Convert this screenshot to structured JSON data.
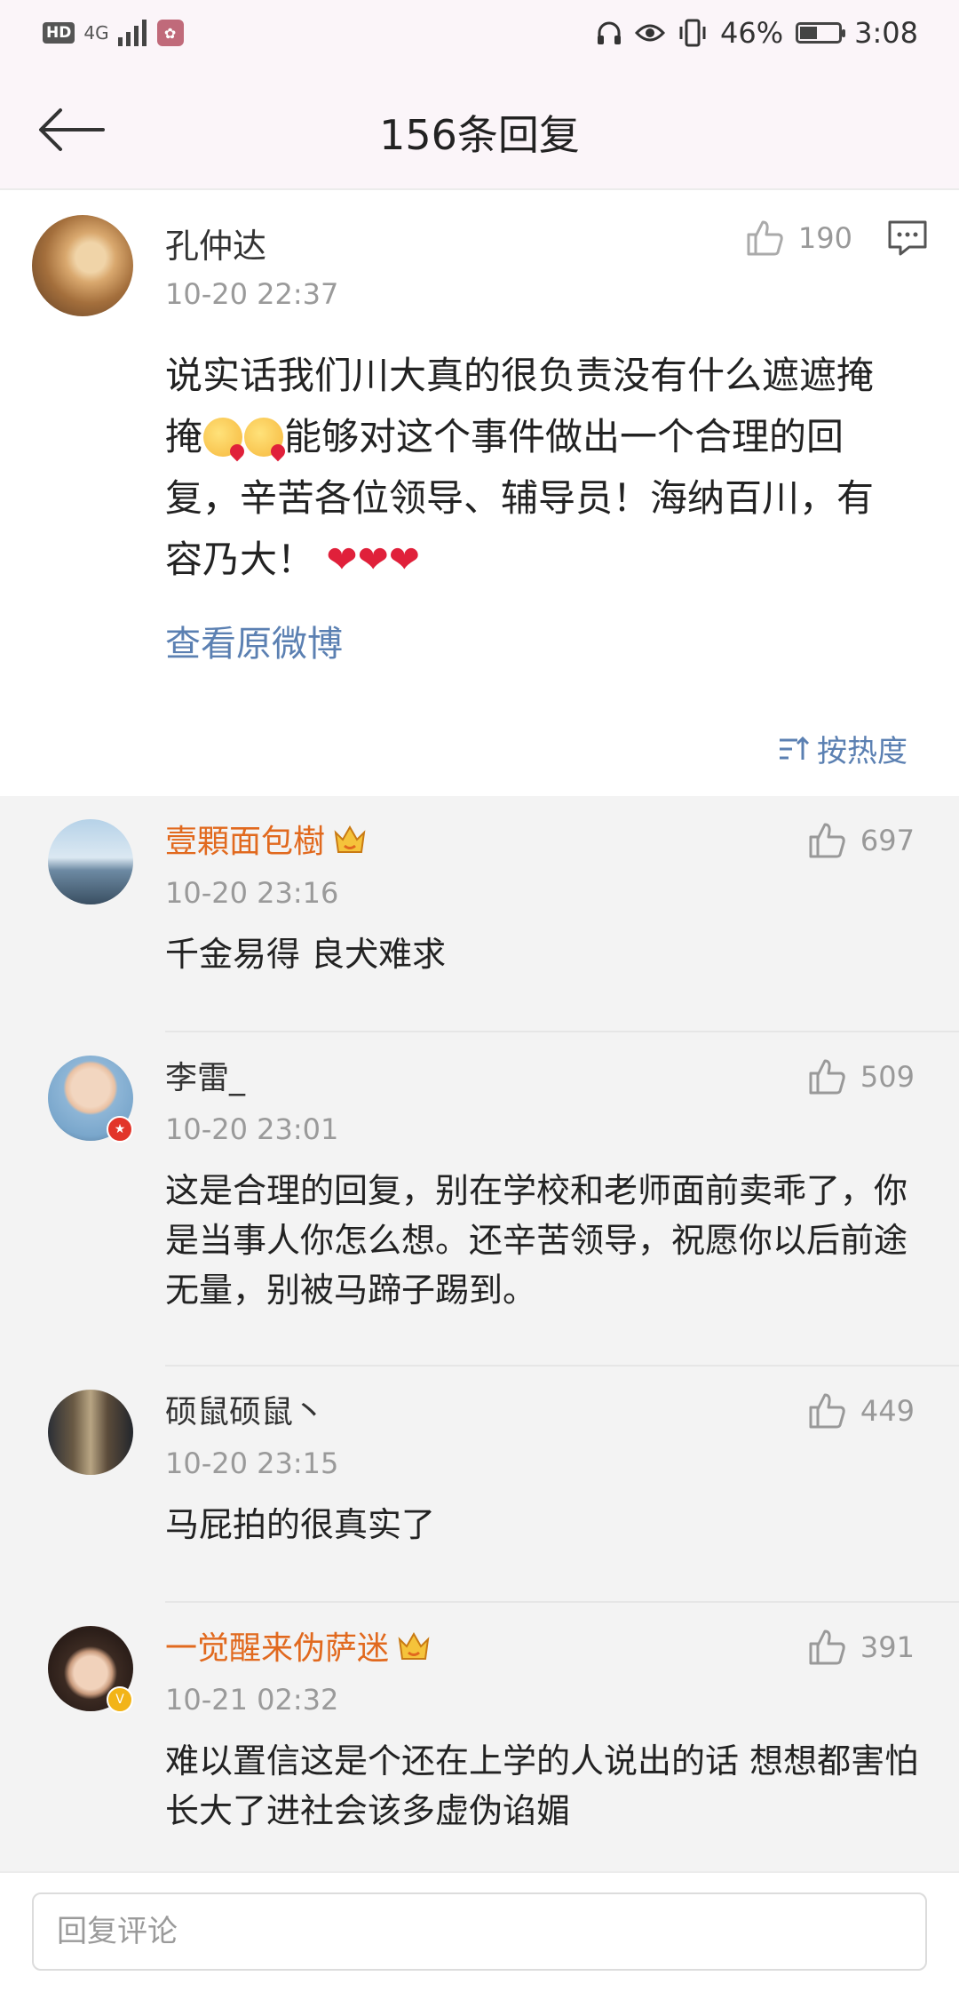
{
  "status_bar": {
    "hd": "HD",
    "network": "4G",
    "battery": "46%",
    "battery_level": 0.46,
    "time": "3:08"
  },
  "nav": {
    "title": "156条回复"
  },
  "main_post": {
    "author": "孔仲达",
    "time": "10-20 22:37",
    "likes": "190",
    "text_part1": "说实话我们川大真的很负责没有什么遮遮掩掩",
    "text_part2": "能够对这个事件做出一个合理的回复，辛苦各位领导、辅导员！海纳百川，有容乃大！",
    "hearts": "❤❤❤",
    "view_original": "查看原微博",
    "sort_label": "按热度"
  },
  "comments": [
    {
      "author": "壹顆面包樹",
      "time": "10-20 23:16",
      "likes": "697",
      "text": "千金易得 良犬难求"
    },
    {
      "author": "李雷_",
      "time": "10-20 23:01",
      "likes": "509",
      "text": "这是合理的回复，别在学校和老师面前卖乖了，你是当事人你怎么想。还辛苦领导，祝愿你以后前途无量，别被马蹄子踢到。"
    },
    {
      "author": "硕鼠硕鼠丶",
      "time": "10-20 23:15",
      "likes": "449",
      "text": "马屁拍的很真实了"
    },
    {
      "author": "一觉醒来伪萨迷",
      "time": "10-21 02:32",
      "likes": "391",
      "text": "难以置信这是个还在上学的人说出的话 想想都害怕 长大了进社会该多虚伪谄媚"
    }
  ],
  "reply": {
    "placeholder": "回复评论"
  },
  "colors": {
    "link": "#5b80b2",
    "vip_name": "#e1691e",
    "heart": "#e0203a"
  }
}
